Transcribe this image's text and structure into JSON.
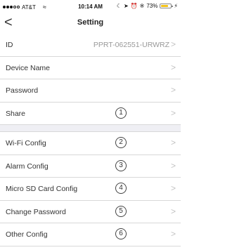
{
  "status_bar": {
    "carrier": "AT&T",
    "time": "10:14 AM",
    "battery_percent": "73%",
    "battery_level": 0.73,
    "signal_icon": "signal-dots-icon",
    "wifi_icon": "wifi-icon"
  },
  "nav": {
    "back_icon": "chevron-left-icon",
    "back_glyph": "<",
    "title": "Setting"
  },
  "section1": [
    {
      "label": "ID",
      "value": "PPRT-062551-URWRZ",
      "chevron": ">"
    },
    {
      "label": "Device Name",
      "chevron": ">"
    },
    {
      "label": "Password",
      "chevron": ">"
    },
    {
      "label": "Share",
      "marker": "1",
      "chevron": ">"
    }
  ],
  "section2": [
    {
      "label": "Wi-Fi Config",
      "marker": "2",
      "chevron": ">"
    },
    {
      "label": "Alarm Config",
      "marker": "3",
      "chevron": ">"
    },
    {
      "label": "Micro SD Card Config",
      "marker": "4",
      "chevron": ">"
    },
    {
      "label": "Change Password",
      "marker": "5",
      "chevron": ">"
    },
    {
      "label": "Other Config",
      "marker": "6",
      "chevron": ">"
    }
  ],
  "colors": {
    "battery": "#f2c21b",
    "separator": "#efeff4",
    "chevron": "#c2c2c2"
  }
}
